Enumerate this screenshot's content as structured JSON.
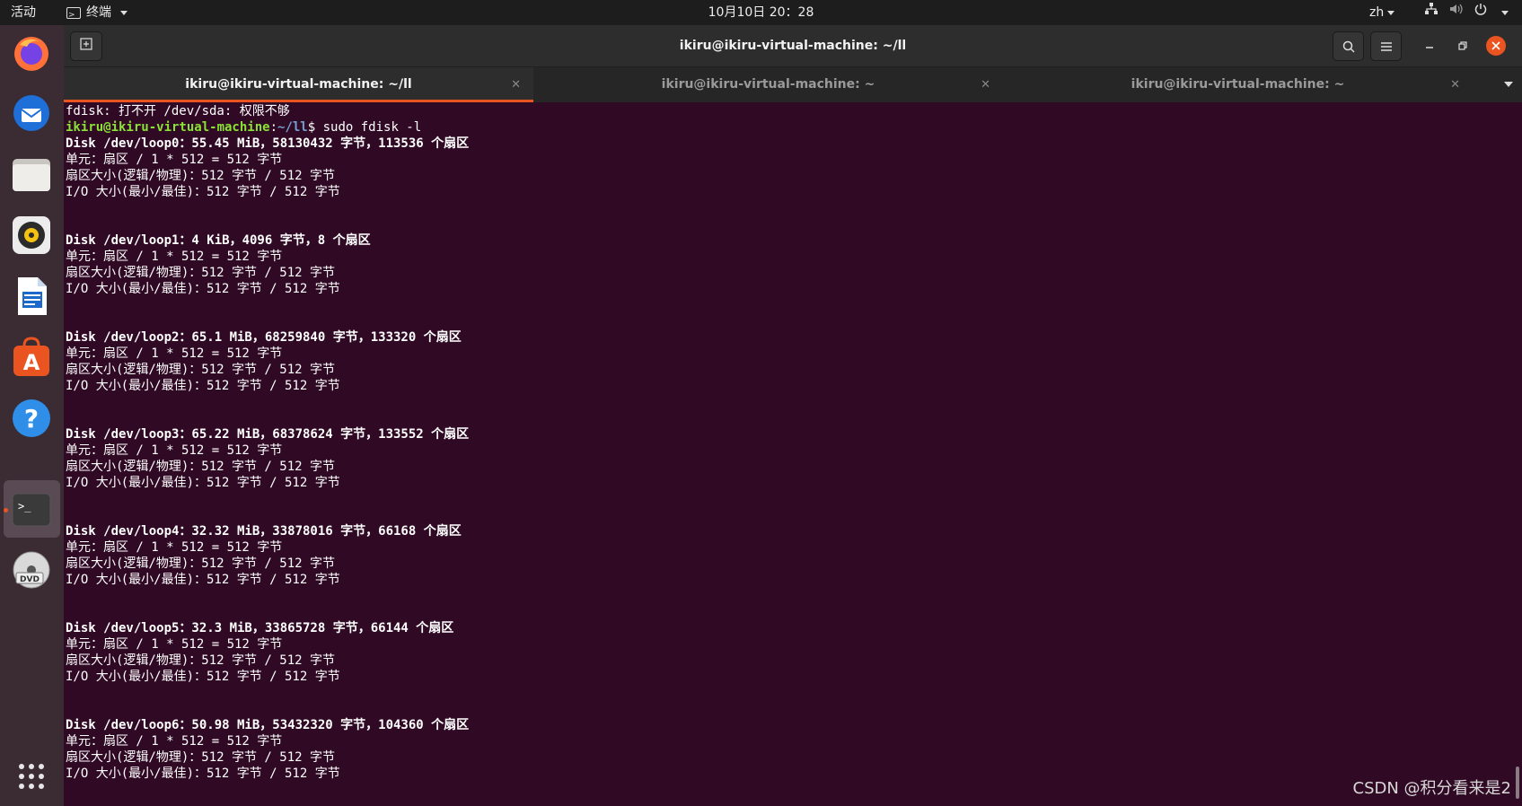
{
  "topbar": {
    "activities": "活动",
    "app_menu": "终端",
    "clock": "10月10日  20：28",
    "lang": "zh",
    "tray_icons": [
      "network-icon",
      "volume-icon",
      "power-icon"
    ]
  },
  "dock": {
    "items": [
      "firefox-icon",
      "thunderbird-icon",
      "files-icon",
      "rhythmbox-icon",
      "libreoffice-writer-icon",
      "software-center-icon",
      "help-icon",
      "terminal-icon",
      "dvd-icon"
    ],
    "show_apps": "app-grid-icon"
  },
  "window": {
    "title": "ikiru@ikiru-virtual-machine: ~/ll",
    "tabs": [
      {
        "label": "ikiru@ikiru-virtual-machine: ~/ll",
        "active": true
      },
      {
        "label": "ikiru@ikiru-virtual-machine: ~",
        "active": false
      },
      {
        "label": "ikiru@ikiru-virtual-machine: ~",
        "active": false
      }
    ]
  },
  "terminal": {
    "error_line": "fdisk: 打不开 /dev/sda: 权限不够",
    "prompt_user": "ikiru@ikiru-virtual-machine",
    "prompt_colon": ":",
    "prompt_path": "~/ll",
    "prompt_dollar": "$ ",
    "command": "sudo fdisk -l",
    "disks": [
      {
        "header": "Disk /dev/loop0：55.45 MiB，58130432 字节，113536 个扇区",
        "unit": "单元：扇区 / 1 * 512 = 512 字节",
        "sector": "扇区大小(逻辑/物理)：512 字节 / 512 字节",
        "io": "I/O 大小(最小/最佳)：512 字节 / 512 字节"
      },
      {
        "header": "Disk /dev/loop1：4 KiB，4096 字节，8 个扇区",
        "unit": "单元：扇区 / 1 * 512 = 512 字节",
        "sector": "扇区大小(逻辑/物理)：512 字节 / 512 字节",
        "io": "I/O 大小(最小/最佳)：512 字节 / 512 字节"
      },
      {
        "header": "Disk /dev/loop2：65.1 MiB，68259840 字节，133320 个扇区",
        "unit": "单元：扇区 / 1 * 512 = 512 字节",
        "sector": "扇区大小(逻辑/物理)：512 字节 / 512 字节",
        "io": "I/O 大小(最小/最佳)：512 字节 / 512 字节"
      },
      {
        "header": "Disk /dev/loop3：65.22 MiB，68378624 字节，133552 个扇区",
        "unit": "单元：扇区 / 1 * 512 = 512 字节",
        "sector": "扇区大小(逻辑/物理)：512 字节 / 512 字节",
        "io": "I/O 大小(最小/最佳)：512 字节 / 512 字节"
      },
      {
        "header": "Disk /dev/loop4：32.32 MiB，33878016 字节，66168 个扇区",
        "unit": "单元：扇区 / 1 * 512 = 512 字节",
        "sector": "扇区大小(逻辑/物理)：512 字节 / 512 字节",
        "io": "I/O 大小(最小/最佳)：512 字节 / 512 字节"
      },
      {
        "header": "Disk /dev/loop5：32.3 MiB，33865728 字节，66144 个扇区",
        "unit": "单元：扇区 / 1 * 512 = 512 字节",
        "sector": "扇区大小(逻辑/物理)：512 字节 / 512 字节",
        "io": "I/O 大小(最小/最佳)：512 字节 / 512 字节"
      },
      {
        "header": "Disk /dev/loop6：50.98 MiB，53432320 字节，104360 个扇区",
        "unit": "单元：扇区 / 1 * 512 = 512 字节",
        "sector": "扇区大小(逻辑/物理)：512 字节 / 512 字节",
        "io": "I/O 大小(最小/最佳)：512 字节 / 512 字节"
      }
    ]
  },
  "watermark": "CSDN @积分看来是2",
  "colors": {
    "terminal_bg": "#300a24",
    "accent": "#e95420",
    "prompt_green": "#8ae234",
    "prompt_blue": "#729fcf"
  }
}
